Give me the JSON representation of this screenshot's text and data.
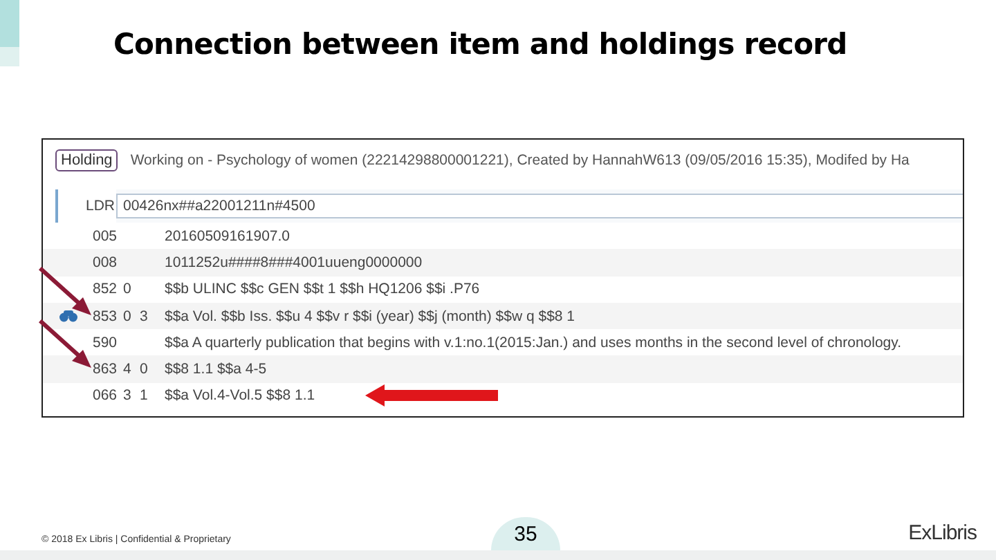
{
  "slide": {
    "title": "Connection between item and holdings record",
    "footer": "© 2018 Ex Libris | Confidential & Proprietary",
    "page_number": "35",
    "logo": "ExLibris"
  },
  "editor": {
    "record_type": "Holding",
    "header": "Working on - Psychology of women (22214298800001221), Created by HannahW613 (09/05/2016 15:35), Modifed by Ha",
    "leader": {
      "tag": "LDR",
      "value": "00426nx##a22001211n#4500"
    },
    "fields": [
      {
        "tag": "005",
        "content": "20160509161907.0",
        "flagged": false,
        "marker": false
      },
      {
        "tag": "008",
        "content": "1011252u####8###4001uueng0000000",
        "flagged": false,
        "marker": false
      },
      {
        "tag": "852",
        "ind1": "0",
        "content": "$$b ULINC $$c GEN $$t 1 $$h HQ1206 $$i .P76",
        "flagged": false,
        "marker": false
      },
      {
        "tag": "853",
        "ind1": "0",
        "ind2": "3",
        "content": "$$a Vol. $$b Iss. $$u 4 $$v r $$i (year) $$j (month) $$w q $$8 1",
        "flagged": true,
        "marker": true
      },
      {
        "tag": "590",
        "content": "$$a A quarterly publication that begins with v.1:no.1(2015:Jan.) and uses months in the second level of chronology.",
        "flagged": false,
        "marker": false
      },
      {
        "tag": "863",
        "ind1": "4",
        "ind2": "0",
        "content": "$$8 1.1 $$a 4-5",
        "flagged": true,
        "marker": false
      },
      {
        "tag": "066",
        "ind1": "3",
        "ind2": "1",
        "content": "$$a Vol.4-Vol.5 $$8 1.1",
        "flagged": false,
        "marker": false,
        "pointer": true
      }
    ]
  }
}
